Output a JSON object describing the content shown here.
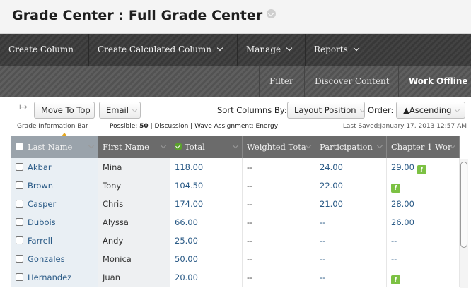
{
  "page": {
    "title": "Grade Center : Full Grade Center"
  },
  "action_bar": {
    "items": [
      {
        "label": "Create Column",
        "has_menu": false
      },
      {
        "label": "Create Calculated Column",
        "has_menu": true
      },
      {
        "label": "Manage",
        "has_menu": true
      },
      {
        "label": "Reports",
        "has_menu": true
      }
    ]
  },
  "sub_bar": {
    "items": [
      {
        "label": "Filter"
      },
      {
        "label": "Discover Content"
      },
      {
        "label": "Work Offline"
      }
    ]
  },
  "toolbar": {
    "move_to_top": "Move To Top",
    "email": "Email",
    "sort_label": "Sort Columns By:",
    "sort_value": "Layout Position",
    "order_label": "Order:",
    "order_value": "▲Ascending"
  },
  "info_bar": {
    "label": "Grade Information Bar",
    "possible_label": "Possible:",
    "possible_value": "50",
    "details": "| Discussion | Wave Assignment: Energy",
    "last_saved": "Last Saved:January 17, 2013 12:57 AM"
  },
  "grid": {
    "columns": [
      "Last Name",
      "First Name",
      "Total",
      "Weighted Tota",
      "Participation",
      "Chapter 1 Wor"
    ],
    "rows": [
      {
        "last": "Akbar",
        "first": "Mina",
        "total": "118.00",
        "weighted": "--",
        "participation": "24.00",
        "chapter1": "29.00",
        "chapter1_alert": true
      },
      {
        "last": "Brown",
        "first": "Tony",
        "total": "104.50",
        "weighted": "--",
        "participation": "22.00",
        "chapter1": "",
        "chapter1_alert": true
      },
      {
        "last": "Casper",
        "first": "Chris",
        "total": "174.00",
        "weighted": "--",
        "participation": "21.00",
        "chapter1": "28.00",
        "chapter1_alert": false
      },
      {
        "last": "Dubois",
        "first": "Alyssa",
        "total": "66.00",
        "weighted": "--",
        "participation": "--",
        "chapter1": "26.00",
        "chapter1_alert": false
      },
      {
        "last": "Farrell",
        "first": "Andy",
        "total": "25.00",
        "weighted": "--",
        "participation": "--",
        "chapter1": "--",
        "chapter1_alert": false
      },
      {
        "last": "Gonzales",
        "first": "Monica",
        "total": "50.00",
        "weighted": "--",
        "participation": "--",
        "chapter1": "--",
        "chapter1_alert": false
      },
      {
        "last": "Hernandez",
        "first": "Juan",
        "total": "20.00",
        "weighted": "--",
        "participation": "--",
        "chapter1": "",
        "chapter1_alert": true
      }
    ]
  },
  "icons": {
    "title_menu": "chevron-down-icon",
    "total_column": "check-circle-icon",
    "needs_grading": "exclamation-icon",
    "move_arrow": "arrow-right-icon"
  },
  "colors": {
    "action_bar": "#3b3b3b",
    "sub_bar": "#555555",
    "grid_header": "#6b6b6b",
    "link": "#2a5a86",
    "alert": "#7cc143",
    "check": "#5aa02c"
  }
}
